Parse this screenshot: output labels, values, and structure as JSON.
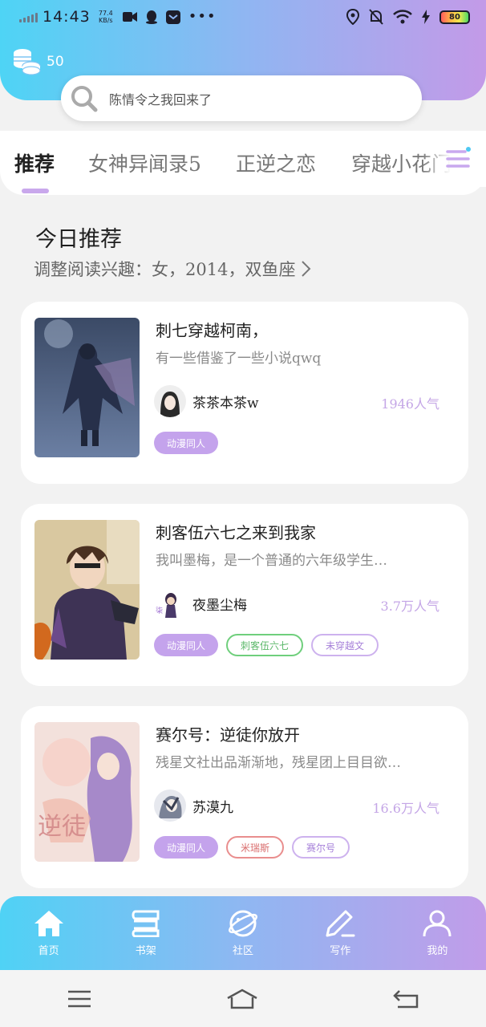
{
  "status_bar": {
    "time": "14:43",
    "speed": "77.4",
    "speed_unit": "KB/s",
    "battery": "80"
  },
  "header": {
    "coins": "50",
    "search_placeholder": "陈情令之我回来了"
  },
  "tabs": [
    {
      "label": "推荐",
      "active": true
    },
    {
      "label": "女神异闻录5",
      "active": false
    },
    {
      "label": "正逆之恋",
      "active": false
    },
    {
      "label": "穿越小花门",
      "active": false
    }
  ],
  "section": {
    "title": "今日推荐",
    "prefs": "调整阅读兴趣：女，2014，双鱼座"
  },
  "books": [
    {
      "title": "刺七穿越柯南，",
      "desc": "有一些借鉴了一些小说qwq",
      "author": "茶茶本茶w",
      "popularity": "1946人气",
      "tags": [
        {
          "label": "动漫同人",
          "style": "fill"
        }
      ]
    },
    {
      "title": "刺客伍六七之来到我家",
      "desc": "我叫墨梅，是一个普通的六年级学生…",
      "author": "夜墨尘梅",
      "popularity": "3.7万人气",
      "tags": [
        {
          "label": "动漫同人",
          "style": "fill"
        },
        {
          "label": "刺客伍六七",
          "style": "green"
        },
        {
          "label": "未穿越文",
          "style": "purple"
        }
      ]
    },
    {
      "title": "赛尔号：逆徒你放开",
      "desc": "残星文社出品渐渐地，残星团上目目欲…",
      "author": "苏漠九",
      "popularity": "16.6万人气",
      "tags": [
        {
          "label": "动漫同人",
          "style": "fill"
        },
        {
          "label": "米瑞斯",
          "style": "red"
        },
        {
          "label": "赛尔号",
          "style": "purple"
        }
      ]
    }
  ],
  "bottom_nav": [
    {
      "label": "首页",
      "icon": "home-icon"
    },
    {
      "label": "书架",
      "icon": "bookshelf-icon"
    },
    {
      "label": "社区",
      "icon": "planet-icon"
    },
    {
      "label": "写作",
      "icon": "pen-icon"
    },
    {
      "label": "我的",
      "icon": "user-icon"
    }
  ],
  "colors": {
    "accent": "#c4a3ec",
    "header_start": "#4ed4f5",
    "header_end": "#c39ae8"
  }
}
